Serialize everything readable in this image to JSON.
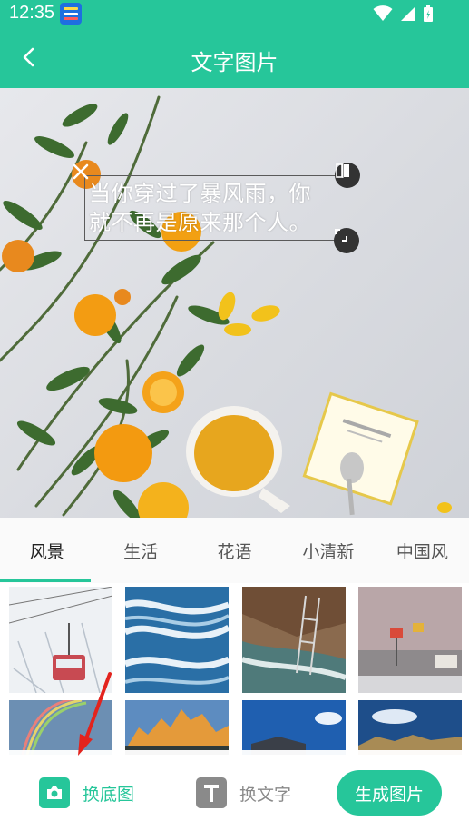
{
  "status_bar": {
    "time": "12:35",
    "icons": [
      "app-notification-icon",
      "wifi-icon",
      "signal-icon",
      "battery-icon"
    ]
  },
  "header": {
    "back_icon": "chevron-left-icon",
    "title": "文字图片"
  },
  "editor": {
    "overlay_text_line1": "当你穿过了暴风雨，你",
    "overlay_text_line2": "就不再是原来那个人。",
    "handles": [
      "close-icon",
      "flip-horizontal-icon",
      "resize-icon"
    ]
  },
  "tabs": [
    {
      "label": "风景",
      "active": true
    },
    {
      "label": "生活",
      "active": false
    },
    {
      "label": "花语",
      "active": false
    },
    {
      "label": "小清新",
      "active": false
    },
    {
      "label": "中国风",
      "active": false
    }
  ],
  "thumbnails": [
    "snowy-cable-car",
    "ocean-waves",
    "river-rocks-ladder",
    "roadside-gas-station",
    "rainbow-sky",
    "mountain-peaks-sunrise",
    "blue-sky-house",
    "mountain-lake"
  ],
  "bottom_bar": {
    "change_background_label": "换底图",
    "change_text_label": "换文字",
    "generate_label": "生成图片"
  },
  "colors": {
    "accent": "#26c69a",
    "inactive": "#8a8a8a",
    "annotation": "#e3231d"
  }
}
